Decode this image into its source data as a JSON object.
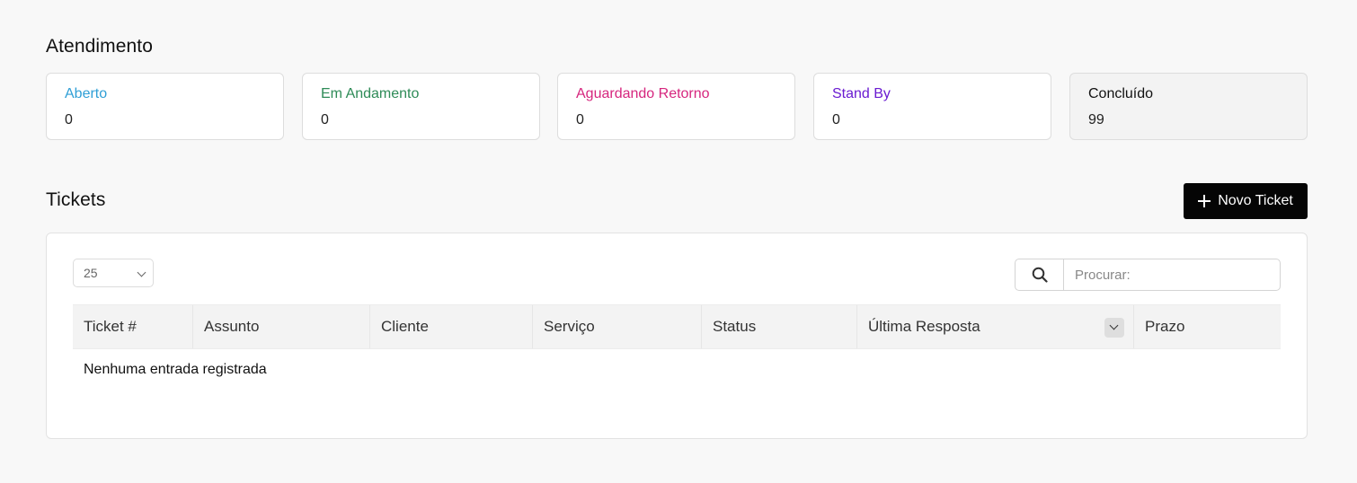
{
  "atendimento": {
    "title": "Atendimento",
    "cards": [
      {
        "label": "Aberto",
        "count": "0",
        "color": "#2f9fd6"
      },
      {
        "label": "Em Andamento",
        "count": "0",
        "color": "#2e8b57"
      },
      {
        "label": "Aguardando Retorno",
        "count": "0",
        "color": "#d6267e"
      },
      {
        "label": "Stand By",
        "count": "0",
        "color": "#6a1bd1"
      },
      {
        "label": "Concluído",
        "count": "99",
        "color": "#111111"
      }
    ]
  },
  "tickets": {
    "title": "Tickets",
    "new_button_label": "Novo Ticket",
    "page_length": "25",
    "search_placeholder": "Procurar:",
    "columns": [
      "Ticket #",
      "Assunto",
      "Cliente",
      "Serviço",
      "Status",
      "Última Resposta",
      "Prazo"
    ],
    "empty_message": "Nenhuma entrada registrada"
  },
  "icons": {
    "new_button": "plus-icon",
    "search": "search-icon",
    "length_select": "chevron-down-icon",
    "sort": "sort-descending-icon"
  }
}
